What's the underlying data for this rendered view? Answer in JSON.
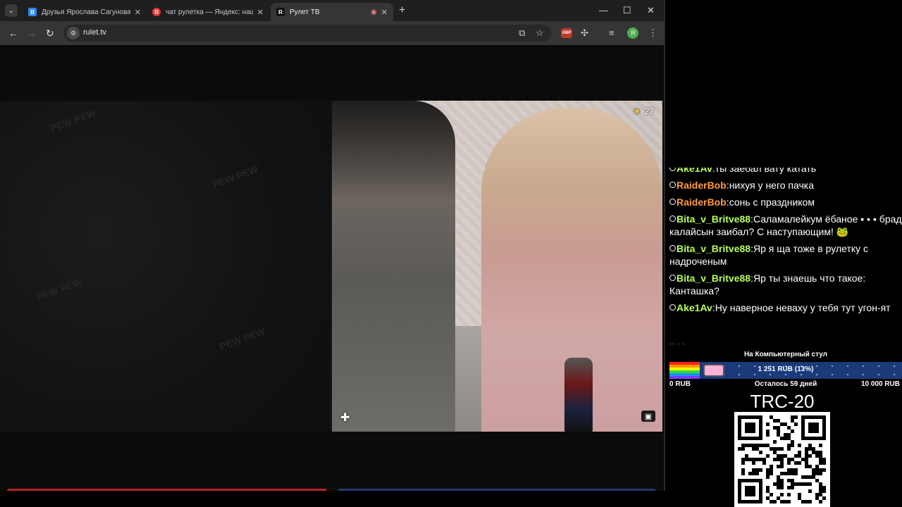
{
  "tabs": [
    {
      "title": "Друзья Ярослава Сагунова – З",
      "icon": "vk-icon",
      "favicon_letter": "B",
      "color": "#2787f5"
    },
    {
      "title": "чат рулетка — Яндекс: нашло",
      "icon": "yandex-icon",
      "favicon_letter": "Я",
      "color": "#e3372f"
    },
    {
      "title": "Рулет ТВ",
      "icon": "rulet-icon",
      "favicon_letter": "R",
      "color": "#111111",
      "active": true,
      "recording": true
    }
  ],
  "address": {
    "url": "rulet.tv"
  },
  "extensions": {
    "abp_label": "ABP",
    "avatar_letter": "Я"
  },
  "video": {
    "rating": "27"
  },
  "background_text": [
    "PEW PEW",
    "PEW PEW",
    "PEW PEW",
    "PEW PEW"
  ],
  "chat": [
    {
      "user": "Ake1Av",
      "user_color": "#b7ff5a",
      "text": "ты заебал вату катать"
    },
    {
      "user": "RaiderBob",
      "user_color": "#ff9c40",
      "text": "нихуя у него пачка"
    },
    {
      "user": "RaiderBob",
      "user_color": "#ff9c40",
      "text": "сонь с праздником"
    },
    {
      "user": "Bita_v_Britve88",
      "user_color": "#b7ff5a",
      "text": "Саламалейкум ёбаное ▪ ▪ ▪ брад калайсын заибал? С наступающим! 🐸"
    },
    {
      "user": "Bita_v_Britve88",
      "user_color": "#b7ff5a",
      "text": "Яр я ща тоже в рулетку с надроченым"
    },
    {
      "user": "Bita_v_Britve88",
      "user_color": "#b7ff5a",
      "text": "Яр ты знаешь что такое: Канташка?"
    },
    {
      "user": "Ake1Av",
      "user_color": "#b7ff5a",
      "text": "Ну наверное неваху у тебя тут угон-ят"
    }
  ],
  "donation": {
    "title": "На Компьютерный стул",
    "amount_text": "1 251 RUB (13%)",
    "progress": 0.13,
    "min_label": "0 RUB",
    "remaining": "Осталось 59 дней",
    "max_label": "10 000 RUB"
  },
  "crypto": {
    "label": "TRC-20"
  }
}
